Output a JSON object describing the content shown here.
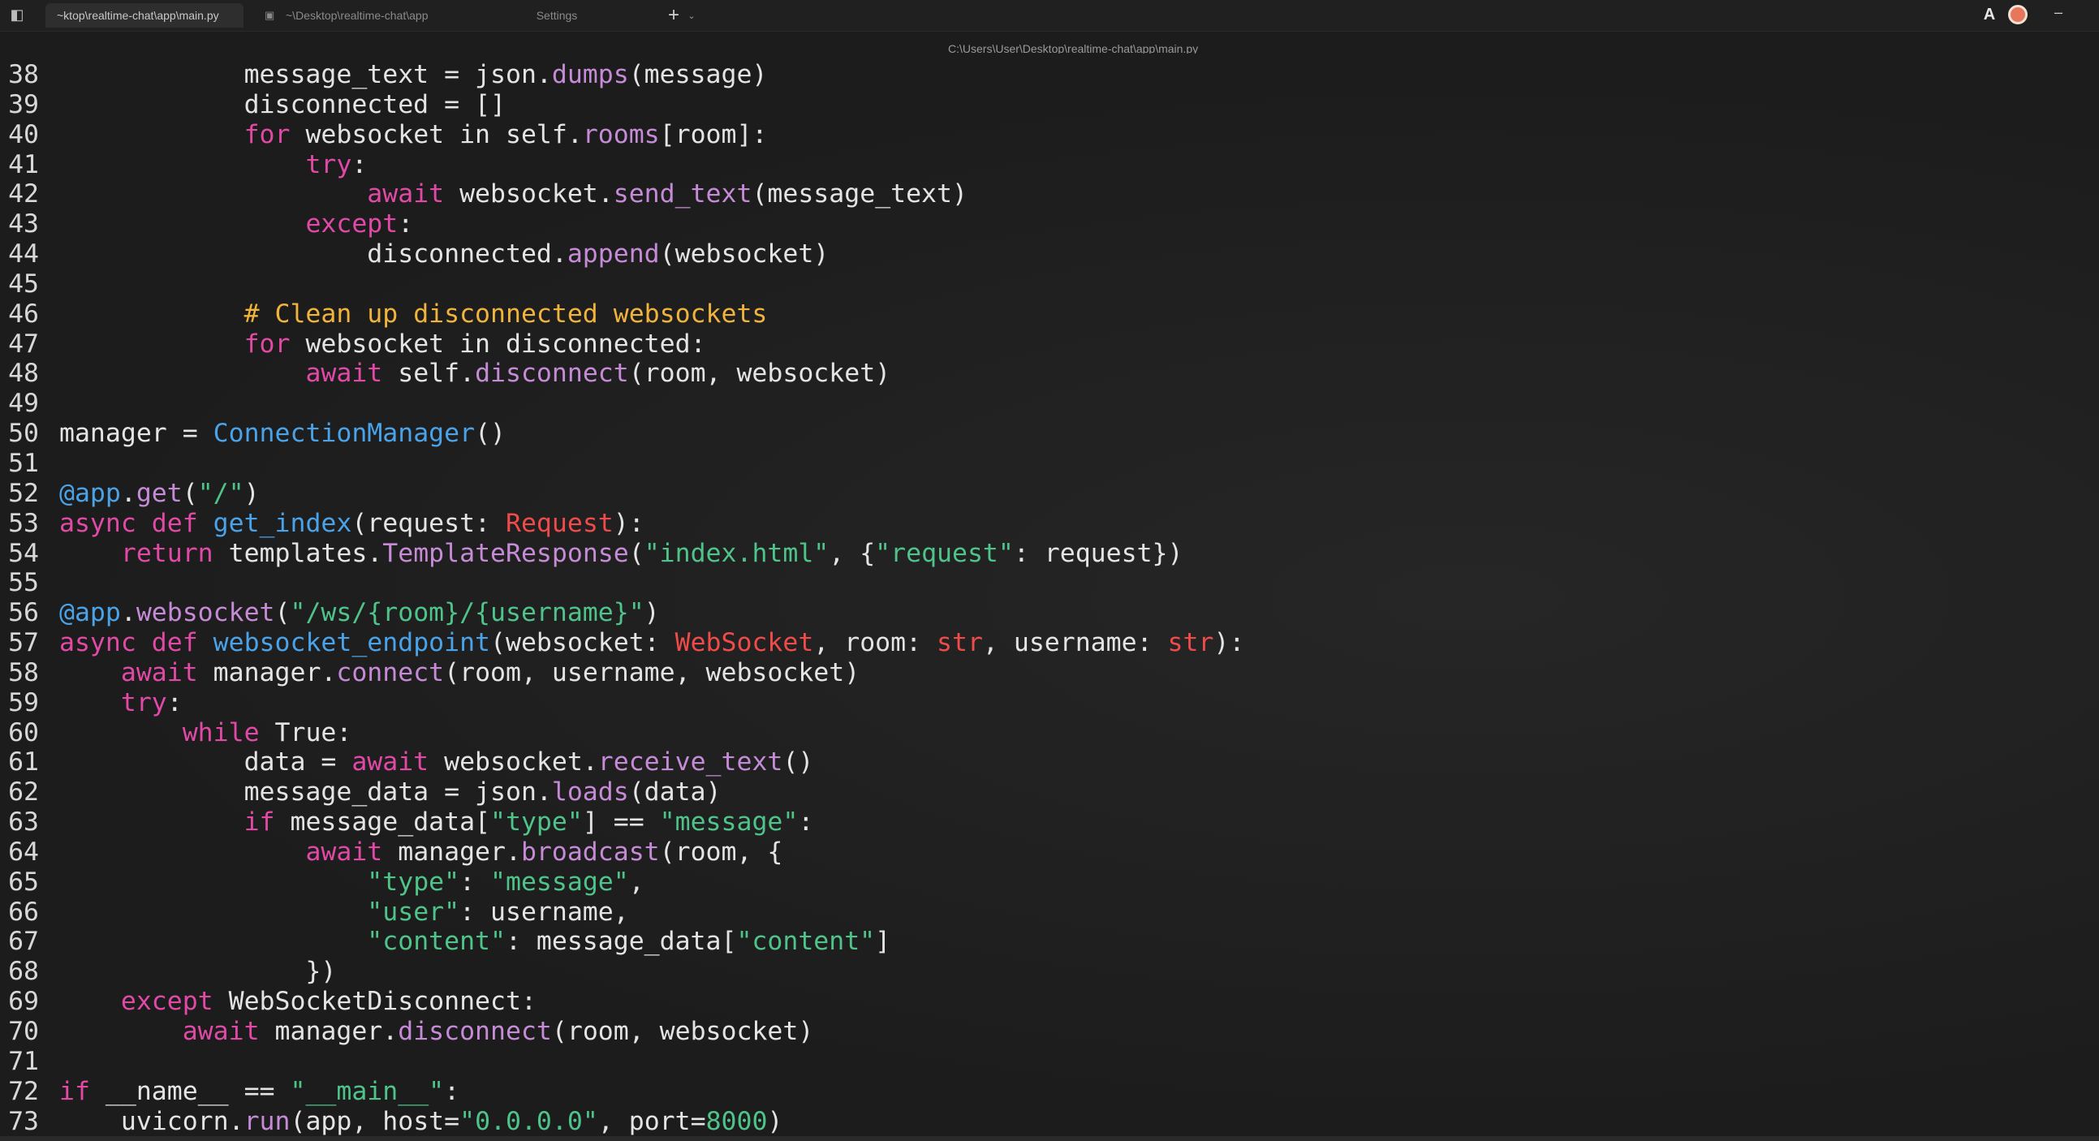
{
  "titlebar": {
    "tabs": [
      {
        "label": "~ktop\\realtime-chat\\app\\main.py",
        "active": true
      },
      {
        "label": "~\\Desktop\\realtime-chat\\app",
        "active": false
      },
      {
        "label": "Settings",
        "active": false
      }
    ],
    "new_tab_glyph": "+",
    "dropdown_glyph": "⌄",
    "sidebar_glyph": "◧",
    "admin_glyph": "A",
    "minimize_glyph": "–"
  },
  "editor": {
    "path": "C:\\Users\\User\\Desktop\\realtime-chat\\app\\main.py",
    "colors": {
      "keyword": "#e04aa6",
      "method": "#c68bd6",
      "definition": "#4aa3e8",
      "string": "#4fc48a",
      "comment": "#f0b43c",
      "type": "#ef4b4b"
    },
    "lines": [
      {
        "n": "38",
        "tokens": [
          [
            "pl",
            "            message_text = json."
          ],
          [
            "fn",
            "dumps"
          ],
          [
            "pl",
            "(message)"
          ]
        ]
      },
      {
        "n": "39",
        "tokens": [
          [
            "pl",
            "            disconnected = []"
          ]
        ]
      },
      {
        "n": "40",
        "tokens": [
          [
            "pl",
            "            "
          ],
          [
            "kw",
            "for"
          ],
          [
            "pl",
            " websocket in self."
          ],
          [
            "fn",
            "rooms"
          ],
          [
            "pl",
            "[room]:"
          ]
        ]
      },
      {
        "n": "41",
        "tokens": [
          [
            "pl",
            "                "
          ],
          [
            "kw",
            "try"
          ],
          [
            "pl",
            ":"
          ]
        ]
      },
      {
        "n": "42",
        "tokens": [
          [
            "pl",
            "                    "
          ],
          [
            "kw",
            "await"
          ],
          [
            "pl",
            " websocket."
          ],
          [
            "fn",
            "send_text"
          ],
          [
            "pl",
            "(message_text)"
          ]
        ]
      },
      {
        "n": "43",
        "tokens": [
          [
            "pl",
            "                "
          ],
          [
            "kw",
            "except"
          ],
          [
            "pl",
            ":"
          ]
        ]
      },
      {
        "n": "44",
        "tokens": [
          [
            "pl",
            "                    disconnected."
          ],
          [
            "fn",
            "append"
          ],
          [
            "pl",
            "(websocket)"
          ]
        ]
      },
      {
        "n": "45",
        "tokens": []
      },
      {
        "n": "46",
        "tokens": [
          [
            "pl",
            "            "
          ],
          [
            "cm",
            "# Clean up disconnected websockets"
          ]
        ]
      },
      {
        "n": "47",
        "tokens": [
          [
            "pl",
            "            "
          ],
          [
            "kw",
            "for"
          ],
          [
            "pl",
            " websocket in disconnected:"
          ]
        ]
      },
      {
        "n": "48",
        "tokens": [
          [
            "pl",
            "                "
          ],
          [
            "kw",
            "await"
          ],
          [
            "pl",
            " self."
          ],
          [
            "fn",
            "disconnect"
          ],
          [
            "pl",
            "(room, websocket)"
          ]
        ]
      },
      {
        "n": "49",
        "tokens": []
      },
      {
        "n": "50",
        "tokens": [
          [
            "pl",
            "manager = "
          ],
          [
            "def",
            "ConnectionManager"
          ],
          [
            "pl",
            "()"
          ]
        ]
      },
      {
        "n": "51",
        "tokens": []
      },
      {
        "n": "52",
        "tokens": [
          [
            "dec",
            "@app"
          ],
          [
            "pl",
            "."
          ],
          [
            "fn",
            "get"
          ],
          [
            "pl",
            "("
          ],
          [
            "str",
            "\"/\""
          ],
          [
            "pl",
            ")"
          ]
        ]
      },
      {
        "n": "53",
        "tokens": [
          [
            "kw",
            "async def "
          ],
          [
            "def",
            "get_index"
          ],
          [
            "pl",
            "(request: "
          ],
          [
            "ty",
            "Request"
          ],
          [
            "pl",
            "):"
          ]
        ]
      },
      {
        "n": "54",
        "tokens": [
          [
            "pl",
            "    "
          ],
          [
            "kw",
            "return"
          ],
          [
            "pl",
            " templates."
          ],
          [
            "fn",
            "TemplateResponse"
          ],
          [
            "pl",
            "("
          ],
          [
            "str",
            "\"index.html\""
          ],
          [
            "pl",
            ", {"
          ],
          [
            "str",
            "\"request\""
          ],
          [
            "pl",
            ": request})"
          ]
        ]
      },
      {
        "n": "55",
        "tokens": []
      },
      {
        "n": "56",
        "tokens": [
          [
            "dec",
            "@app"
          ],
          [
            "pl",
            "."
          ],
          [
            "fn",
            "websocket"
          ],
          [
            "pl",
            "("
          ],
          [
            "str",
            "\"/ws/{room}/{username}\""
          ],
          [
            "pl",
            ")"
          ]
        ]
      },
      {
        "n": "57",
        "tokens": [
          [
            "kw",
            "async def "
          ],
          [
            "def",
            "websocket_endpoint"
          ],
          [
            "pl",
            "(websocket: "
          ],
          [
            "ty",
            "WebSocket"
          ],
          [
            "pl",
            ", room: "
          ],
          [
            "ty",
            "str"
          ],
          [
            "pl",
            ", username: "
          ],
          [
            "ty",
            "str"
          ],
          [
            "pl",
            "):"
          ]
        ]
      },
      {
        "n": "58",
        "tokens": [
          [
            "pl",
            "    "
          ],
          [
            "kw",
            "await"
          ],
          [
            "pl",
            " manager."
          ],
          [
            "fn",
            "connect"
          ],
          [
            "pl",
            "(room, username, websocket)"
          ]
        ]
      },
      {
        "n": "59",
        "tokens": [
          [
            "pl",
            "    "
          ],
          [
            "kw",
            "try"
          ],
          [
            "pl",
            ":"
          ]
        ]
      },
      {
        "n": "60",
        "tokens": [
          [
            "pl",
            "        "
          ],
          [
            "kw",
            "while"
          ],
          [
            "pl",
            " True:"
          ]
        ]
      },
      {
        "n": "61",
        "tokens": [
          [
            "pl",
            "            data = "
          ],
          [
            "kw",
            "await"
          ],
          [
            "pl",
            " websocket."
          ],
          [
            "fn",
            "receive_text"
          ],
          [
            "pl",
            "()"
          ]
        ]
      },
      {
        "n": "62",
        "tokens": [
          [
            "pl",
            "            message_data = json."
          ],
          [
            "fn",
            "loads"
          ],
          [
            "pl",
            "(data)"
          ]
        ]
      },
      {
        "n": "63",
        "tokens": [
          [
            "pl",
            "            "
          ],
          [
            "kw",
            "if"
          ],
          [
            "pl",
            " message_data["
          ],
          [
            "str",
            "\"type\""
          ],
          [
            "pl",
            "] == "
          ],
          [
            "str",
            "\"message\""
          ],
          [
            "pl",
            ":"
          ]
        ]
      },
      {
        "n": "64",
        "tokens": [
          [
            "pl",
            "                "
          ],
          [
            "kw",
            "await"
          ],
          [
            "pl",
            " manager."
          ],
          [
            "fn",
            "broadcast"
          ],
          [
            "pl",
            "(room, {"
          ]
        ]
      },
      {
        "n": "65",
        "tokens": [
          [
            "pl",
            "                    "
          ],
          [
            "str",
            "\"type\""
          ],
          [
            "pl",
            ": "
          ],
          [
            "str",
            "\"message\""
          ],
          [
            "pl",
            ","
          ]
        ]
      },
      {
        "n": "66",
        "tokens": [
          [
            "pl",
            "                    "
          ],
          [
            "str",
            "\"user\""
          ],
          [
            "pl",
            ": username,"
          ]
        ]
      },
      {
        "n": "67",
        "tokens": [
          [
            "pl",
            "                    "
          ],
          [
            "str",
            "\"content\""
          ],
          [
            "pl",
            ": message_data["
          ],
          [
            "str",
            "\"content\""
          ],
          [
            "pl",
            "]"
          ]
        ]
      },
      {
        "n": "68",
        "tokens": [
          [
            "pl",
            "                })"
          ]
        ]
      },
      {
        "n": "69",
        "tokens": [
          [
            "pl",
            "    "
          ],
          [
            "kw",
            "except"
          ],
          [
            "pl",
            " WebSocketDisconnect:"
          ]
        ]
      },
      {
        "n": "70",
        "tokens": [
          [
            "pl",
            "        "
          ],
          [
            "kw",
            "await"
          ],
          [
            "pl",
            " manager."
          ],
          [
            "fn",
            "disconnect"
          ],
          [
            "pl",
            "(room, websocket)"
          ]
        ]
      },
      {
        "n": "71",
        "tokens": []
      },
      {
        "n": "72",
        "tokens": [
          [
            "kw",
            "if"
          ],
          [
            "pl",
            " __name__ == "
          ],
          [
            "str",
            "\"__main__\""
          ],
          [
            "pl",
            ":"
          ]
        ]
      },
      {
        "n": "73",
        "tokens": [
          [
            "pl",
            "    uvicorn."
          ],
          [
            "fn",
            "run"
          ],
          [
            "pl",
            "(app, host="
          ],
          [
            "str",
            "\"0.0.0.0\""
          ],
          [
            "pl",
            ", port="
          ],
          [
            "num",
            "8000"
          ],
          [
            "pl",
            ")"
          ]
        ]
      }
    ]
  }
}
